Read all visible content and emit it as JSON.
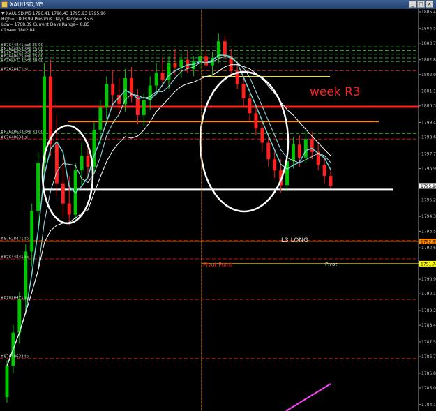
{
  "window": {
    "title": "XAUUSD,M5",
    "controls": [
      "_",
      "□",
      "×"
    ]
  },
  "info_panel": {
    "lines": [
      "▼ XAUUSD,M5  1796.41 1796.43 1795.93 1795.96",
      "High= 1803.99    Previous Days Range= 35.6",
      "Low= 1768.39     Current Days Range= 8.85",
      "Close= 1802.84"
    ]
  },
  "order_labels": [
    {
      "text": "#87644841 sell 25.00",
      "price": 1803.5
    },
    {
      "text": "#87644853 sell 25.00",
      "price": 1803.3
    },
    {
      "text": "#87630025 sell 25.00",
      "price": 1803.1
    },
    {
      "text": "#87640625 sell 25.00",
      "price": 1802.9
    },
    {
      "text": "#87644713 sell 30.00",
      "price": 1802.7
    },
    {
      "text": "#87628471 sl",
      "price": 1802.2
    },
    {
      "text": "#87640633 sell 33.00",
      "price": 1798.8
    },
    {
      "text": "#87640633 sl",
      "price": 1798.5
    },
    {
      "text": "#87628471 tp",
      "price": 1793.0
    },
    {
      "text": "#87644841 tp",
      "price": 1792.0
    },
    {
      "text": "#87626471 tp",
      "price": 1789.8
    },
    {
      "text": "#87640633 tp",
      "price": 1786.6
    }
  ],
  "annotations": {
    "week_r3": "week R3",
    "l3_long": "L3 LONG",
    "pivot_point": "Pivot Point",
    "pivot": "Pivot"
  },
  "price_tags": [
    {
      "text": "1795.96",
      "price": 1795.96,
      "color": "#ffffff",
      "text_color": "#000000"
    },
    {
      "text": "1792.95",
      "price": 1792.95,
      "color": "#ff8c00",
      "text_color": "#000000"
    },
    {
      "text": "1791.74",
      "price": 1791.74,
      "color": "#ffff00",
      "text_color": "#000000"
    }
  ],
  "colors": {
    "background": "#000000",
    "bull": "#00c800",
    "bear": "#ff2020",
    "week_r3": "#ff2020",
    "orange_level": "#ff8c00",
    "white_level": "#ffffff",
    "yellow_level": "#e8e800",
    "ma_fast": "#6fd3d3",
    "ma_mid": "#a8e0e8",
    "ma_slow": "#ffffff",
    "magenta": "#ff44ff",
    "axis_text": "#c0c0c0"
  },
  "chart_data": {
    "type": "candlestick",
    "symbol": "XAUUSD",
    "timeframe": "M5",
    "y_ticks": [
      1805.4,
      1804.5,
      1803.7,
      1802.8,
      1802.0,
      1801.1,
      1800.3,
      1799.4,
      1798.6,
      1797.7,
      1796.9,
      1796.0,
      1795.2,
      1794.3,
      1793.5,
      1792.6,
      1791.8,
      1790.9,
      1790.1,
      1789.2,
      1788.4,
      1787.5,
      1786.7,
      1785.8,
      1785.0,
      1784.1
    ],
    "ylim": [
      1783.75,
      1805.55
    ],
    "levels": [
      {
        "name": "week R3",
        "price": 1800.25,
        "color": "#ff2020",
        "style": "solid",
        "width": 3
      },
      {
        "name": "orange",
        "price": 1799.45,
        "color": "#ff8c00",
        "style": "solid",
        "width": 2
      },
      {
        "name": "white",
        "price": 1795.75,
        "color": "#ffffff",
        "style": "solid",
        "width": 3
      },
      {
        "name": "yellow",
        "price": 1801.9,
        "color": "#e8e800",
        "style": "solid",
        "width": 1
      },
      {
        "name": "L3 LONG",
        "price": 1792.95,
        "color": "#ff8c00",
        "style": "solid",
        "width": 1
      },
      {
        "name": "Pivot",
        "price": 1791.74,
        "color": "#e8e800",
        "style": "solid",
        "width": 1
      }
    ],
    "candles": [
      [
        1784.5,
        1786.5,
        1784.2,
        1786.2
      ],
      [
        1786.2,
        1788.4,
        1785.8,
        1788.0
      ],
      [
        1788.0,
        1790.2,
        1787.4,
        1789.8
      ],
      [
        1789.8,
        1792.8,
        1789.0,
        1792.4
      ],
      [
        1792.4,
        1795.0,
        1791.6,
        1794.6
      ],
      [
        1794.6,
        1797.8,
        1793.8,
        1797.2
      ],
      [
        1797.2,
        1802.6,
        1796.4,
        1801.9
      ],
      [
        1801.9,
        1802.8,
        1797.6,
        1798.2
      ],
      [
        1798.2,
        1799.8,
        1795.4,
        1796.1
      ],
      [
        1796.1,
        1797.5,
        1794.2,
        1795.0
      ],
      [
        1795.0,
        1796.5,
        1793.8,
        1794.4
      ],
      [
        1794.4,
        1797.2,
        1794.0,
        1796.8
      ],
      [
        1796.8,
        1798.3,
        1796.0,
        1797.6
      ],
      [
        1797.6,
        1798.4,
        1796.3,
        1797.0
      ],
      [
        1797.0,
        1799.4,
        1796.6,
        1799.0
      ],
      [
        1799.0,
        1800.6,
        1798.2,
        1800.2
      ],
      [
        1800.2,
        1801.9,
        1799.6,
        1801.5
      ],
      [
        1801.5,
        1802.2,
        1800.3,
        1800.9
      ],
      [
        1800.9,
        1801.8,
        1799.8,
        1800.4
      ],
      [
        1800.4,
        1802.3,
        1800.0,
        1801.8
      ],
      [
        1801.8,
        1802.4,
        1800.5,
        1800.8
      ],
      [
        1800.8,
        1801.2,
        1799.3,
        1799.8
      ],
      [
        1799.8,
        1801.0,
        1799.2,
        1800.6
      ],
      [
        1800.6,
        1801.9,
        1800.1,
        1801.4
      ],
      [
        1801.4,
        1802.6,
        1800.9,
        1802.1
      ],
      [
        1802.1,
        1802.9,
        1801.3,
        1801.7
      ],
      [
        1801.7,
        1803.0,
        1801.2,
        1802.6
      ],
      [
        1802.6,
        1803.4,
        1802.0,
        1802.4
      ],
      [
        1802.4,
        1803.1,
        1801.8,
        1802.8
      ],
      [
        1802.8,
        1803.3,
        1802.1,
        1802.3
      ],
      [
        1802.3,
        1803.0,
        1801.9,
        1802.7
      ],
      [
        1802.7,
        1803.5,
        1802.2,
        1803.0
      ],
      [
        1803.0,
        1803.4,
        1802.3,
        1802.5
      ],
      [
        1802.5,
        1803.2,
        1802.0,
        1802.9
      ],
      [
        1802.9,
        1804.2,
        1802.6,
        1803.8
      ],
      [
        1803.8,
        1804.1,
        1802.8,
        1803.0
      ],
      [
        1803.0,
        1803.4,
        1801.9,
        1802.2
      ],
      [
        1802.2,
        1802.6,
        1801.2,
        1801.5
      ],
      [
        1801.5,
        1801.9,
        1800.3,
        1800.7
      ],
      [
        1800.7,
        1801.0,
        1799.5,
        1799.9
      ],
      [
        1799.9,
        1800.3,
        1798.7,
        1799.1
      ],
      [
        1799.1,
        1799.5,
        1797.8,
        1798.3
      ],
      [
        1798.3,
        1798.8,
        1797.0,
        1797.4
      ],
      [
        1797.4,
        1797.9,
        1796.4,
        1796.8
      ],
      [
        1796.8,
        1797.4,
        1795.6,
        1796.0
      ],
      [
        1796.0,
        1797.6,
        1795.7,
        1797.3
      ],
      [
        1797.3,
        1798.6,
        1796.9,
        1798.2
      ],
      [
        1798.2,
        1798.7,
        1797.0,
        1797.5
      ],
      [
        1797.5,
        1798.9,
        1797.2,
        1798.5
      ],
      [
        1798.5,
        1798.9,
        1797.4,
        1797.8
      ],
      [
        1797.8,
        1798.3,
        1796.8,
        1797.1
      ],
      [
        1797.1,
        1797.5,
        1796.1,
        1796.5
      ],
      [
        1796.5,
        1796.9,
        1795.8,
        1795.96
      ]
    ]
  }
}
